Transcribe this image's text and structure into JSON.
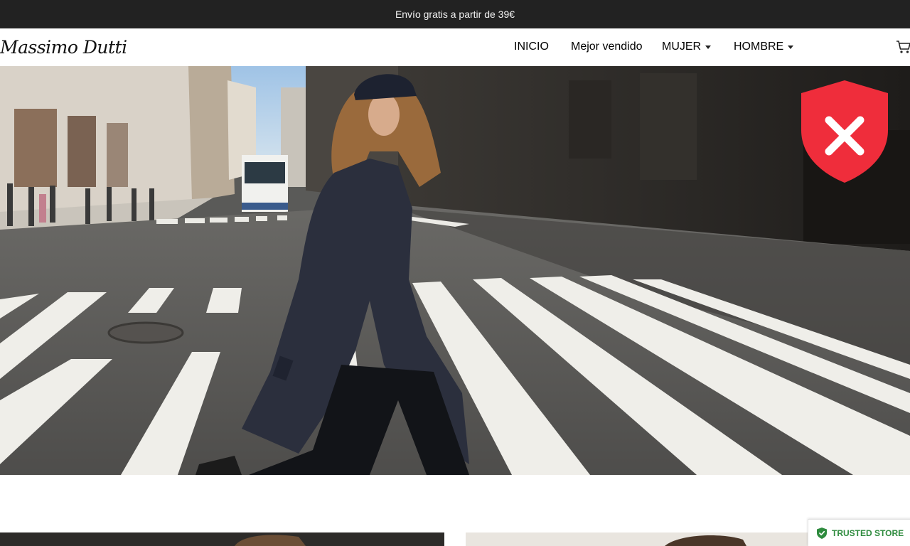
{
  "announcement": {
    "text": "Envío gratis a partir de 39€"
  },
  "header": {
    "logo_text": "Massimo Dutti",
    "nav": [
      {
        "label": "INICIO",
        "has_dropdown": false
      },
      {
        "label": "Mejor vendido",
        "has_dropdown": false
      },
      {
        "label": "MUJER",
        "has_dropdown": true
      },
      {
        "label": "HOMBRE",
        "has_dropdown": true
      }
    ],
    "cart_icon": "cart-icon"
  },
  "security_badge": {
    "icon": "shield-x-icon",
    "color": "#ef2d3b"
  },
  "trusted_badge": {
    "label": "TRUSTED STORE",
    "icon": "shield-check-icon",
    "color": "#2e8b3e"
  }
}
